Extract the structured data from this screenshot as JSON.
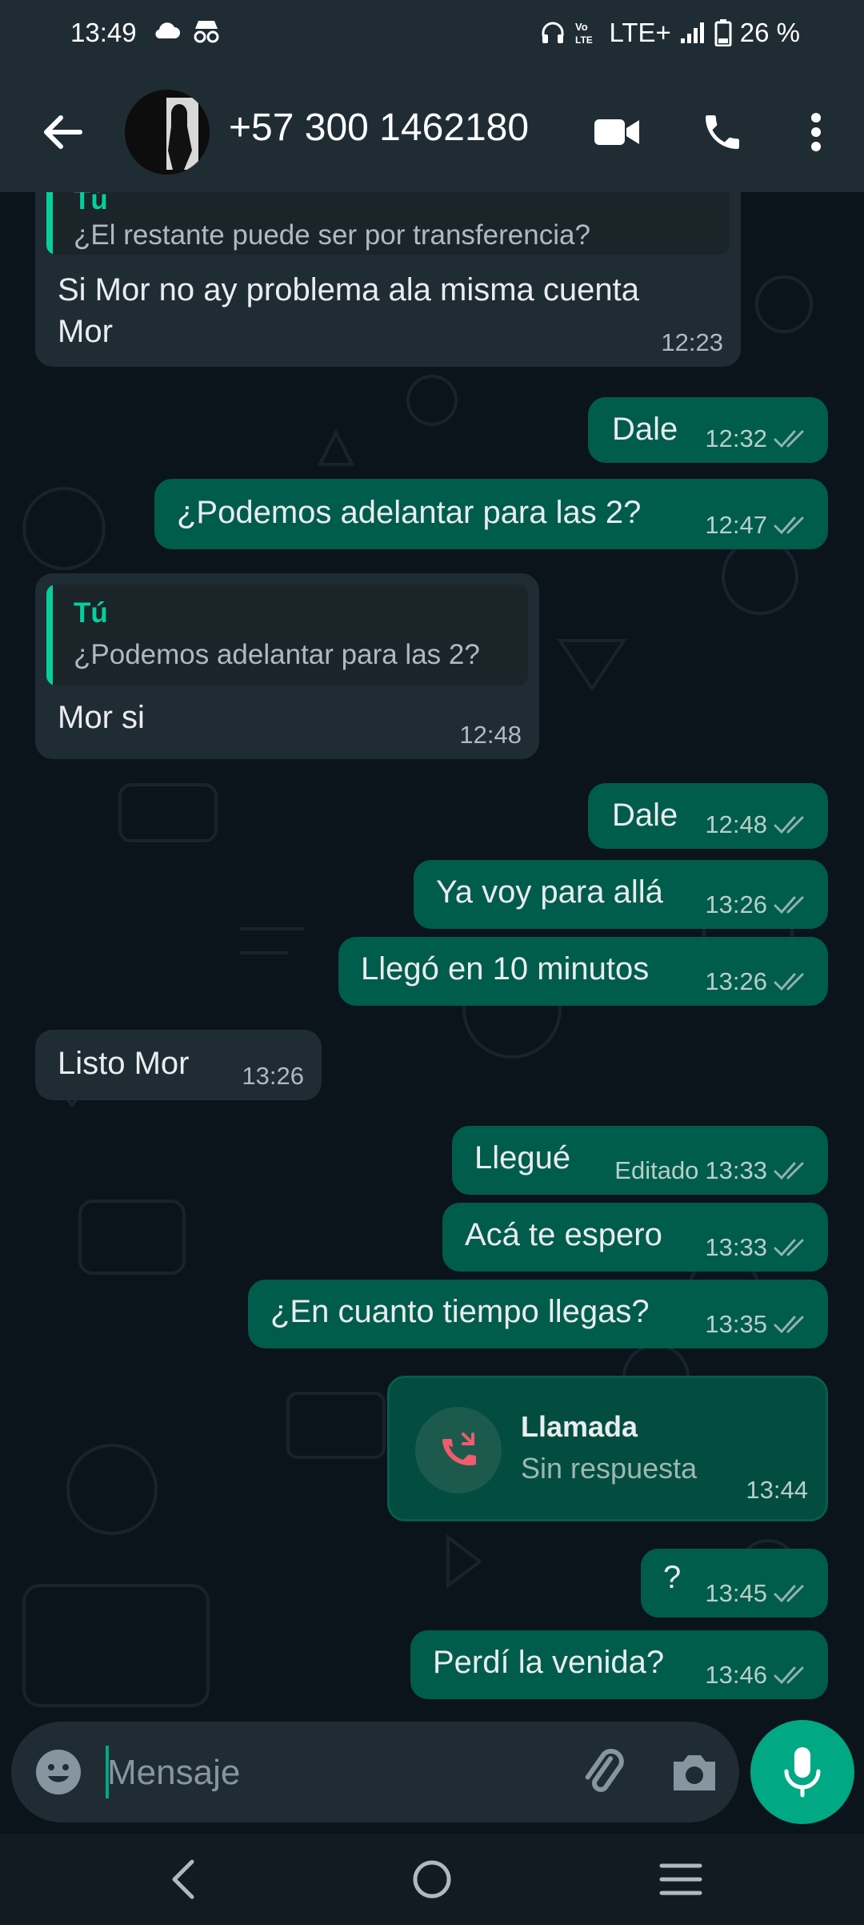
{
  "status_bar": {
    "time": "13:49",
    "network": "LTE+",
    "battery": "26 %"
  },
  "header": {
    "contact_name": "+57 300 1462180"
  },
  "messages": [
    {
      "dir": "in",
      "reply_author": "Tú",
      "reply_text": "¿El restante puede ser por transferencia?",
      "text_line1": "Si Mor no ay problema ala misma cuenta",
      "text_line2": "Mor",
      "time": "12:23"
    },
    {
      "dir": "out",
      "text": "Dale",
      "time": "12:32"
    },
    {
      "dir": "out",
      "text": "¿Podemos adelantar para las 2?",
      "time": "12:47"
    },
    {
      "dir": "in",
      "reply_author": "Tú",
      "reply_text": "¿Podemos adelantar para las 2?",
      "text": "Mor si",
      "time": "12:48"
    },
    {
      "dir": "out",
      "text": "Dale",
      "time": "12:48"
    },
    {
      "dir": "out",
      "text": "Ya voy para allá",
      "time": "13:26"
    },
    {
      "dir": "out",
      "text": "Llegó en 10 minutos",
      "time": "13:26"
    },
    {
      "dir": "in",
      "text": "Listo Mor",
      "time": "13:26"
    },
    {
      "dir": "out",
      "text": "Llegué",
      "edited": "Editado",
      "time": "13:33"
    },
    {
      "dir": "out",
      "text": "Acá te espero",
      "time": "13:33"
    },
    {
      "dir": "out",
      "text": "¿En cuanto tiempo llegas?",
      "time": "13:35"
    },
    {
      "dir": "out",
      "type": "call",
      "title": "Llamada",
      "subtitle": "Sin respuesta",
      "time": "13:44"
    },
    {
      "dir": "out",
      "text": "?",
      "time": "13:45"
    },
    {
      "dir": "out",
      "text": "Perdí la venida?",
      "time": "13:46"
    }
  ],
  "composer": {
    "placeholder": "Mensaje"
  },
  "colors": {
    "incoming": "#202c33",
    "outgoing": "#005c4b",
    "accent": "#00a884",
    "ticks": "#8fb4ad"
  }
}
